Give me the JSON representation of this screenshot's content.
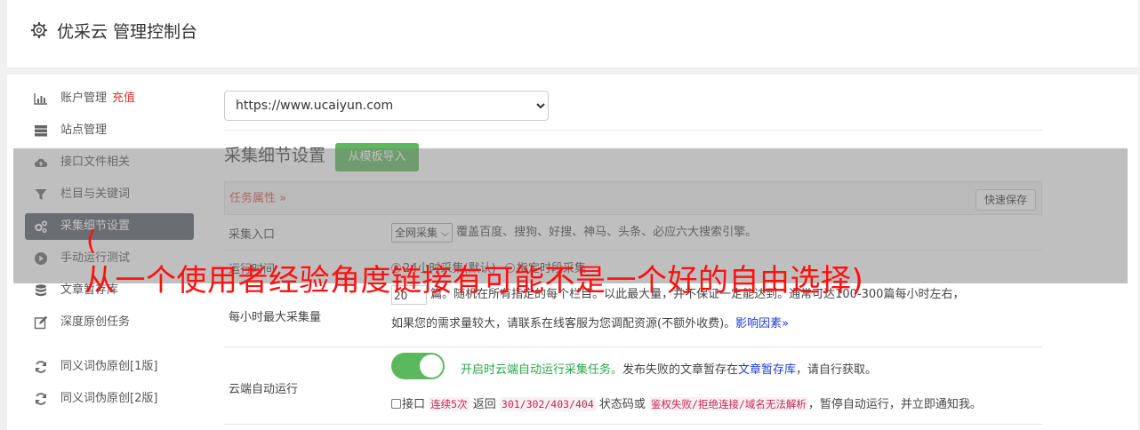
{
  "header": {
    "title": "优采云 管理控制台"
  },
  "sidebar": {
    "items": [
      {
        "label": "账户管理",
        "badge": "充值"
      },
      {
        "label": "站点管理"
      },
      {
        "label": "接口文件相关"
      },
      {
        "label": "栏目与关键词"
      },
      {
        "label": "采集细节设置"
      },
      {
        "label": "手动运行测试"
      },
      {
        "label": "文章暂存库"
      },
      {
        "label": "深度原创任务"
      },
      {
        "label": "同义词伪原创[1版]"
      },
      {
        "label": "同义词伪原创[2版]"
      }
    ]
  },
  "content": {
    "site_select": "https://www.ucaiyun.com",
    "section_title": "采集细节设置",
    "template_button": "从模板导入",
    "panel_tab": "任务属性 »",
    "quick_save": "快速保存",
    "rows": {
      "entry": {
        "label": "采集入口",
        "select": "全网采集",
        "desc": "覆盖百度、搜狗、好搜、神马、头条、必应六大搜索引擎。"
      },
      "runtime": {
        "label": "运行时间",
        "opt1": "24小时采集(默认)",
        "opt2": "指定时段采集"
      },
      "maxrate": {
        "label": "每小时最大采集量",
        "value": "20",
        "line1": "篇。随机在所有指定的每个栏目。以此最大量，并不保证一定能达到。通常可达100-300篇每小时左右，",
        "line2": "如果您的需求量较大，请联系在线客服为您调配资源(不额外收费)。",
        "link": "影响因素»"
      },
      "cloud": {
        "label": "云端自动运行",
        "green_text": "开启时云端自动运行采集任务。",
        "text_after": "发布失败的文章暂存在",
        "link": "文章暂存库",
        "text_end": "，请自行获取。",
        "l2_a": "接口",
        "code1": "连续5次",
        "l2_b": "返回",
        "code2": "301/302/403/404",
        "l2_c": "状态码或",
        "code3": "鉴权失败/拒绝连接/域名无法解析",
        "l2_d": "，暂停自动运行，并立即通知我。"
      }
    }
  },
  "overlay": {
    "paren": "(",
    "text": "从一个使用者经验角度链接有可能不是一个好的自由选择)"
  },
  "colors": {
    "accent_green": "#5cb85c",
    "danger": "#d9534f",
    "link_blue": "#1a3bd6",
    "sidebar_active": "#555d66",
    "overlay_text": "#ff1010"
  }
}
